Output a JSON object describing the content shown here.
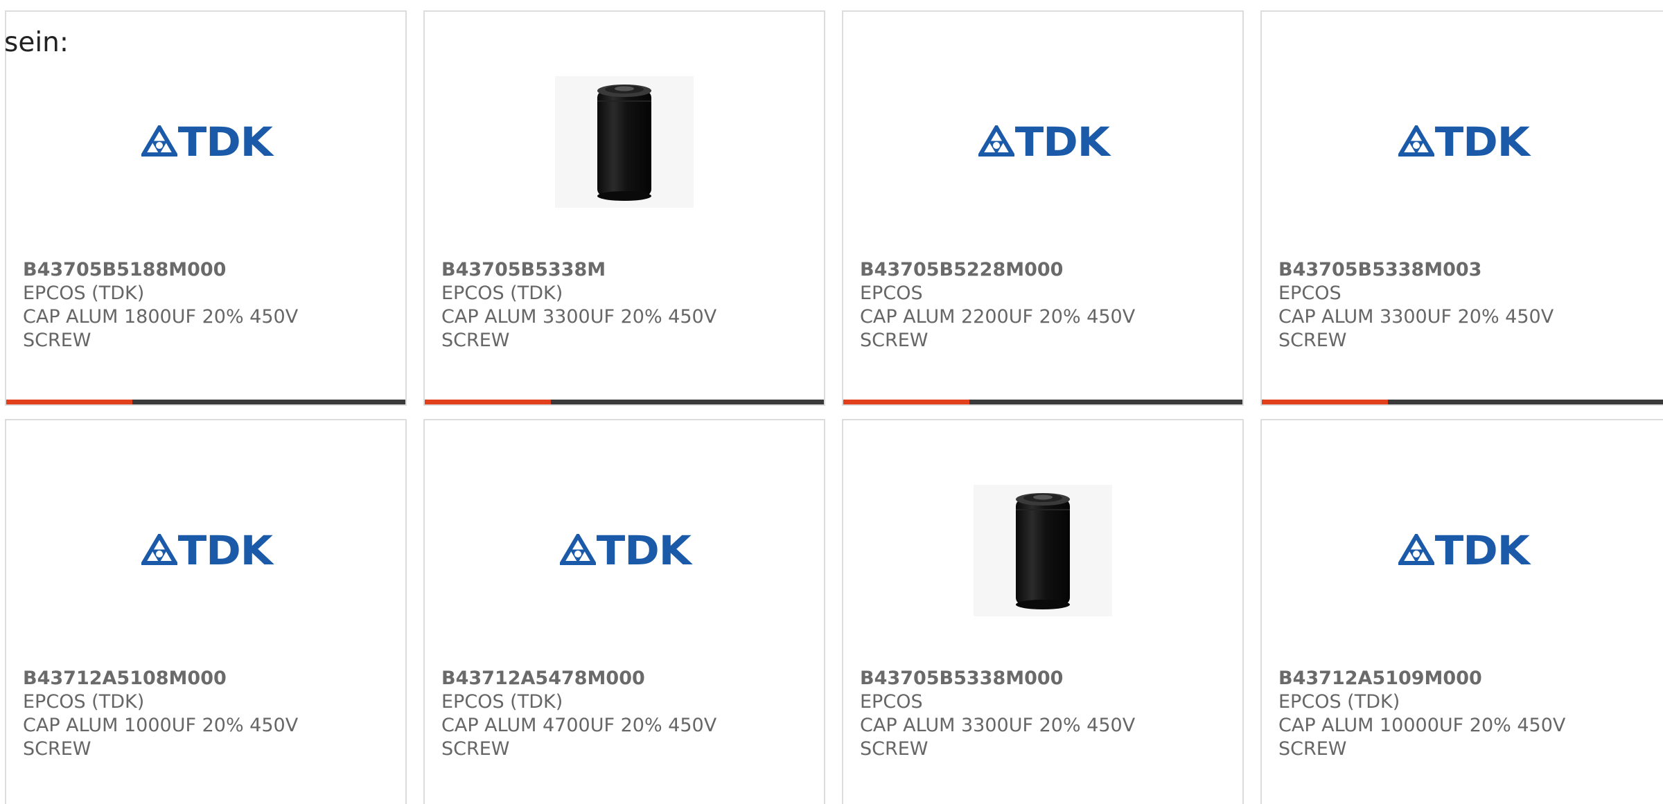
{
  "intro_text": "sein:",
  "colors": {
    "accent": "#e2401c",
    "bar": "#3a3a3a",
    "tdk_blue": "#1a5aa8",
    "text": "#666666",
    "border": "#dcdcdc"
  },
  "cards": [
    {
      "part_number": "B43705B5188M000",
      "manufacturer": "EPCOS (TDK)",
      "description_line1": "CAP ALUM 1800UF 20% 450V",
      "description_line2": "SCREW",
      "image": "tdk-logo",
      "logo_text": "TDK"
    },
    {
      "part_number": "B43705B5338M",
      "manufacturer": "EPCOS (TDK)",
      "description_line1": "CAP ALUM 3300UF 20% 450V",
      "description_line2": "SCREW",
      "image": "capacitor-photo"
    },
    {
      "part_number": "B43705B5228M000",
      "manufacturer": "EPCOS",
      "description_line1": "CAP ALUM 2200UF 20% 450V",
      "description_line2": "SCREW",
      "image": "tdk-logo",
      "logo_text": "TDK"
    },
    {
      "part_number": "B43705B5338M003",
      "manufacturer": "EPCOS",
      "description_line1": "CAP ALUM 3300UF 20% 450V",
      "description_line2": "SCREW",
      "image": "tdk-logo",
      "logo_text": "TDK"
    },
    {
      "part_number": "B43712A5108M000",
      "manufacturer": "EPCOS (TDK)",
      "description_line1": "CAP ALUM 1000UF 20% 450V",
      "description_line2": "SCREW",
      "image": "tdk-logo",
      "logo_text": "TDK"
    },
    {
      "part_number": "B43712A5478M000",
      "manufacturer": "EPCOS (TDK)",
      "description_line1": "CAP ALUM 4700UF 20% 450V",
      "description_line2": "SCREW",
      "image": "tdk-logo",
      "logo_text": "TDK"
    },
    {
      "part_number": "B43705B5338M000",
      "manufacturer": "EPCOS",
      "description_line1": "CAP ALUM 3300UF 20% 450V",
      "description_line2": "SCREW",
      "image": "capacitor-photo"
    },
    {
      "part_number": "B43712A5109M000",
      "manufacturer": "EPCOS (TDK)",
      "description_line1": "CAP ALUM 10000UF 20% 450V",
      "description_line2": "SCREW",
      "image": "tdk-logo",
      "logo_text": "TDK"
    }
  ]
}
